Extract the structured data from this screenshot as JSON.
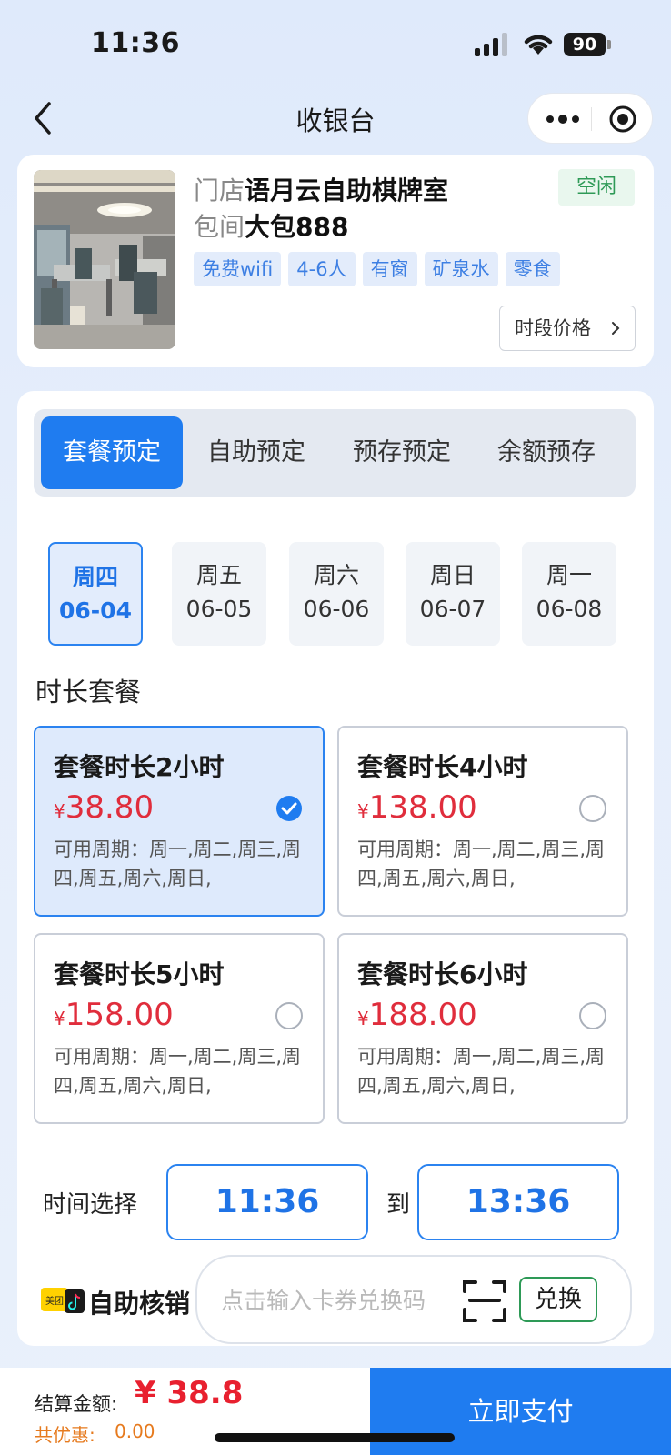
{
  "status_bar": {
    "time": "11:36",
    "battery": "90"
  },
  "nav": {
    "title": "收银台"
  },
  "store": {
    "store_prefix": "门店",
    "store_name": "语月云自助棋牌室",
    "room_prefix": "包间",
    "room_name": "大包888",
    "status": "空闲",
    "tags": [
      "免费wifi",
      "4-6人",
      "有窗",
      "矿泉水",
      "零食"
    ],
    "price_button": "时段价格"
  },
  "tabs": [
    {
      "label": "套餐预定",
      "active": true
    },
    {
      "label": "自助预定",
      "active": false
    },
    {
      "label": "预存预定",
      "active": false
    },
    {
      "label": "余额预存",
      "active": false
    }
  ],
  "days": [
    {
      "weekday": "周四",
      "date": "06-04",
      "active": true
    },
    {
      "weekday": "周五",
      "date": "06-05",
      "active": false
    },
    {
      "weekday": "周六",
      "date": "06-06",
      "active": false
    },
    {
      "weekday": "周日",
      "date": "06-07",
      "active": false
    },
    {
      "weekday": "周一",
      "date": "06-08",
      "active": false
    }
  ],
  "packages_title": "时长套餐",
  "packages": [
    {
      "name": "套餐时长2小时",
      "currency": "¥",
      "price": "38.80",
      "available_days": "可用周期：周一,周二,周三,周四,周五,周六,周日,",
      "selected": true
    },
    {
      "name": "套餐时长4小时",
      "currency": "¥",
      "price": "138.00",
      "available_days": "可用周期：周一,周二,周三,周四,周五,周六,周日,",
      "selected": false
    },
    {
      "name": "套餐时长5小时",
      "currency": "¥",
      "price": "158.00",
      "available_days": "可用周期：周一,周二,周三,周四,周五,周六,周日,",
      "selected": false
    },
    {
      "name": "套餐时长6小时",
      "currency": "¥",
      "price": "188.00",
      "available_days": "可用周期：周一,周二,周三,周四,周五,周六,周日,",
      "selected": false
    }
  ],
  "time_select": {
    "label": "时间选择",
    "start": "11:36",
    "separator": "到",
    "end": "13:36"
  },
  "coupon": {
    "logo_text": "美团",
    "label": "自助核销",
    "placeholder": "点击输入卡券兑换码",
    "redeem_button": "兑换"
  },
  "footer": {
    "total_label": "结算金额:",
    "total_value": "¥ 38.8",
    "discount_label": "共优惠:",
    "discount_value": "0.00",
    "pay_button": "立即支付"
  },
  "colors": {
    "primary": "#1f7cf0",
    "price_red": "#e02d3c",
    "status_green": "#2e9a57",
    "discount_orange": "#e67a1e"
  }
}
